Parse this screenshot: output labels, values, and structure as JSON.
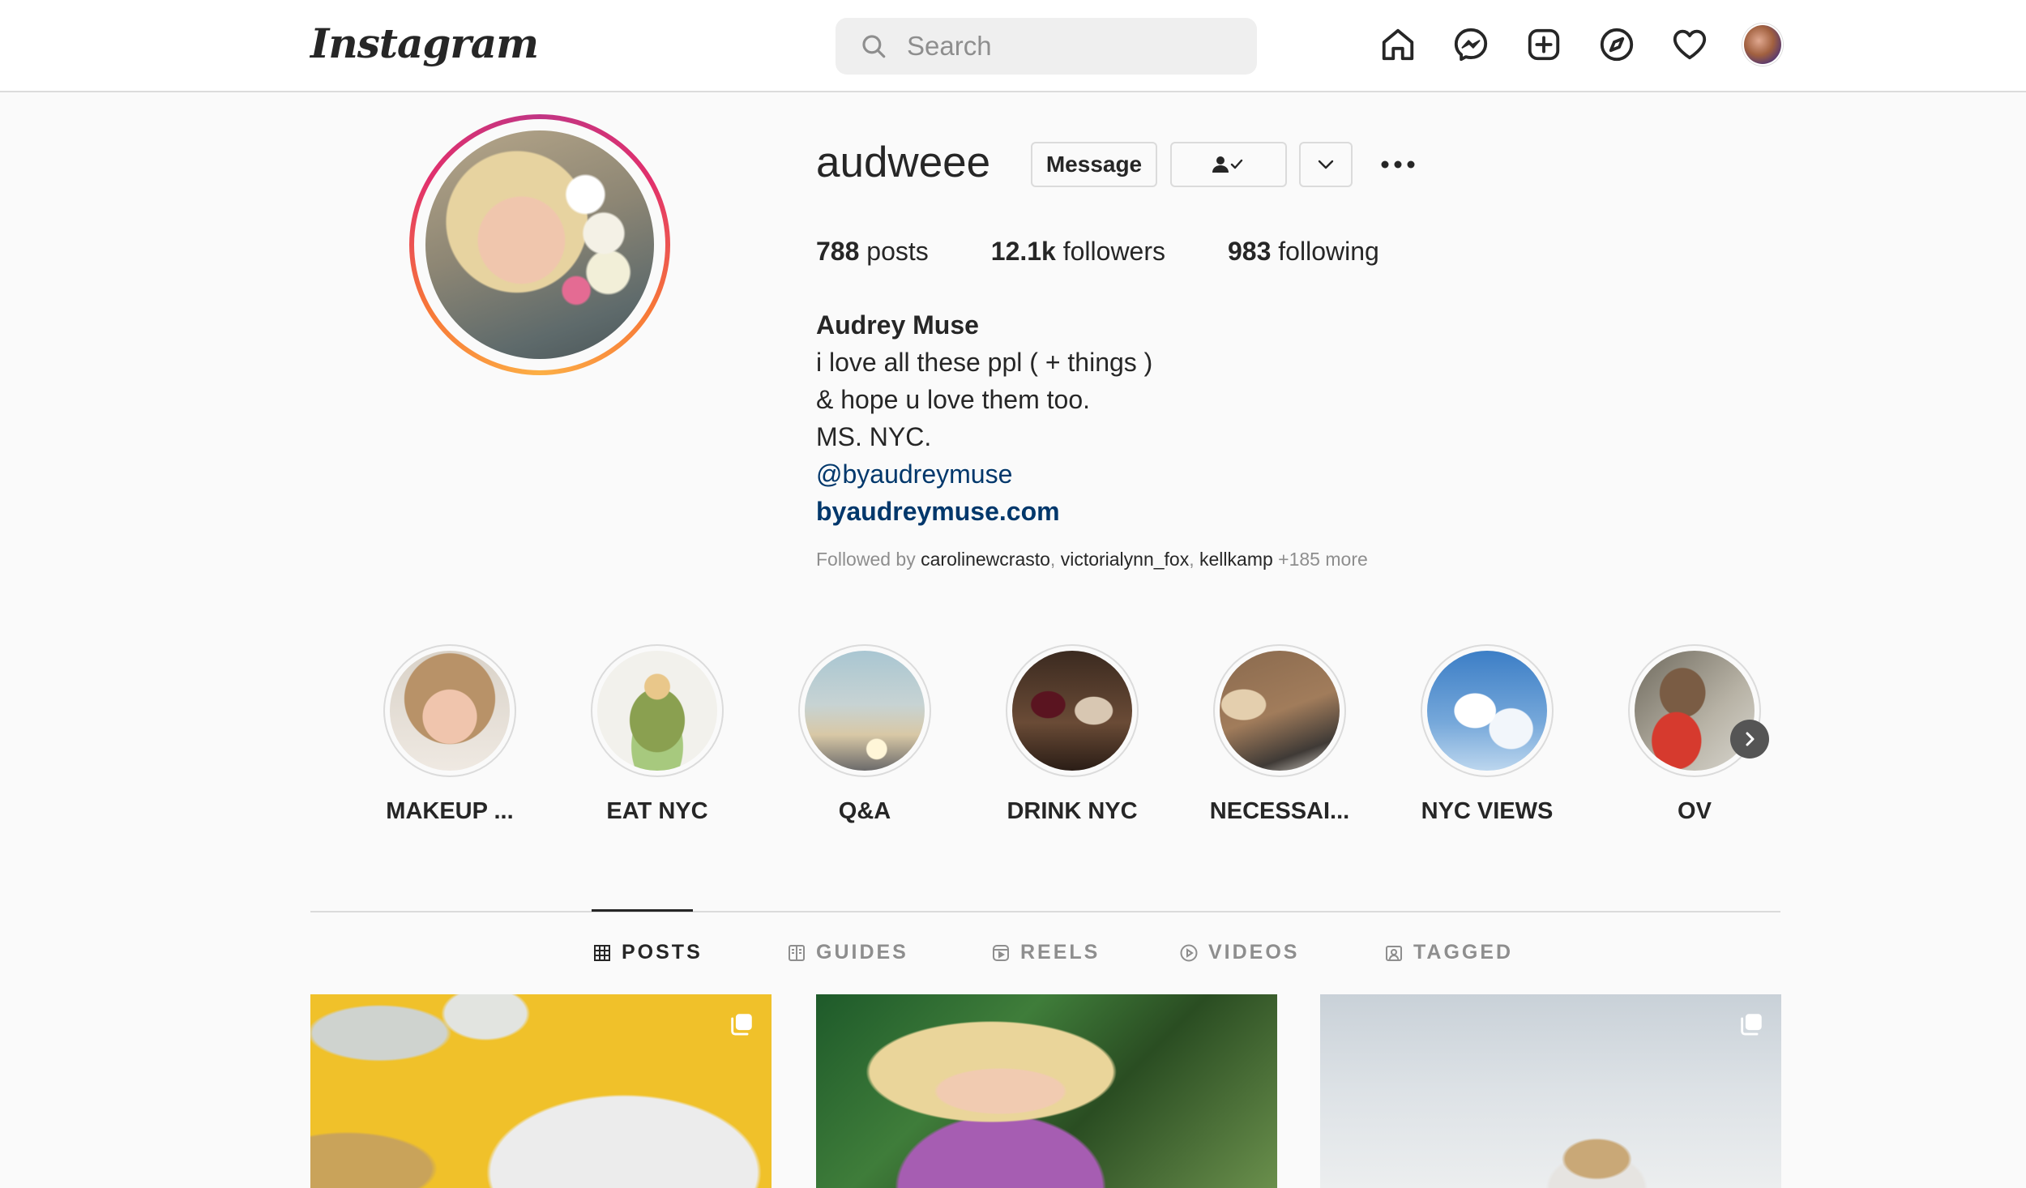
{
  "nav": {
    "logo": "Instagram",
    "search_placeholder": "Search",
    "icons": [
      "home-icon",
      "messenger-icon",
      "new-post-icon",
      "explore-icon",
      "activity-heart-icon",
      "profile-avatar"
    ]
  },
  "profile": {
    "username": "audweee",
    "message_label": "Message",
    "stats": {
      "posts_count": "788",
      "posts_label": "posts",
      "followers_count": "12.1k",
      "followers_label": "followers",
      "following_count": "983",
      "following_label": "following"
    },
    "bio": {
      "full_name": "Audrey Muse",
      "line1": "i love all these ppl ( + things )",
      "line2": "& hope u love them too.",
      "line3": "MS. NYC.",
      "mention": "@byaudreymuse",
      "website": "byaudreymuse.com"
    },
    "followed_by": {
      "prefix": "Followed by",
      "names": [
        "carolinewcrasto",
        "victorialynn_fox",
        "kellkamp"
      ],
      "more": "+185 more"
    }
  },
  "highlights": [
    {
      "label": "MAKEUP ..."
    },
    {
      "label": "EAT NYC"
    },
    {
      "label": "Q&A"
    },
    {
      "label": "DRINK NYC"
    },
    {
      "label": "NECESSAI..."
    },
    {
      "label": "NYC VIEWS"
    },
    {
      "label": "OV"
    }
  ],
  "tabs": [
    {
      "label": "POSTS",
      "active": true
    },
    {
      "label": "GUIDES",
      "active": false
    },
    {
      "label": "REELS",
      "active": false
    },
    {
      "label": "VIDEOS",
      "active": false
    },
    {
      "label": "TAGGED",
      "active": false
    }
  ],
  "colors": {
    "link": "#00376b",
    "border": "#dbdbdb",
    "muted": "#8e8e8e",
    "text": "#262626",
    "background": "#fafafa"
  }
}
